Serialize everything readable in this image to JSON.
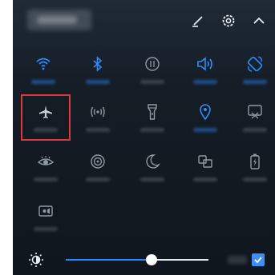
{
  "colors": {
    "active": "#2f8cff",
    "inactive": "#8f9aa5",
    "highlight": "#e0383a",
    "slider_fill": "#1f88ff",
    "checkbox": "#3e8ff5"
  },
  "header": {
    "icons": [
      "edit-icon",
      "settings-gear-icon",
      "collapse-chevron-up-icon"
    ]
  },
  "tiles": [
    {
      "icon": "wifi-icon",
      "state": "on"
    },
    {
      "icon": "bluetooth-icon",
      "state": "on"
    },
    {
      "icon": "mobile-data-icon",
      "state": "off"
    },
    {
      "icon": "sound-icon",
      "state": "on"
    },
    {
      "icon": "auto-rotate-icon",
      "state": "on"
    },
    {
      "icon": "airplane-mode-icon",
      "state": "off",
      "highlighted": true
    },
    {
      "icon": "hotspot-icon",
      "state": "off"
    },
    {
      "icon": "flashlight-icon",
      "state": "off"
    },
    {
      "icon": "location-icon",
      "state": "on"
    },
    {
      "icon": "screenshot-icon",
      "state": "off"
    },
    {
      "icon": "eye-comfort-icon",
      "state": "off"
    },
    {
      "icon": "huawei-share-icon",
      "state": "off"
    },
    {
      "icon": "do-not-disturb-moon-icon",
      "state": "off"
    },
    {
      "icon": "screen-mirror-icon",
      "state": "off"
    },
    {
      "icon": "battery-saver-icon",
      "state": "off"
    },
    {
      "icon": "screen-recorder-icon",
      "state": "off"
    }
  ],
  "brightness": {
    "level": 0.6,
    "auto_enabled": true
  }
}
